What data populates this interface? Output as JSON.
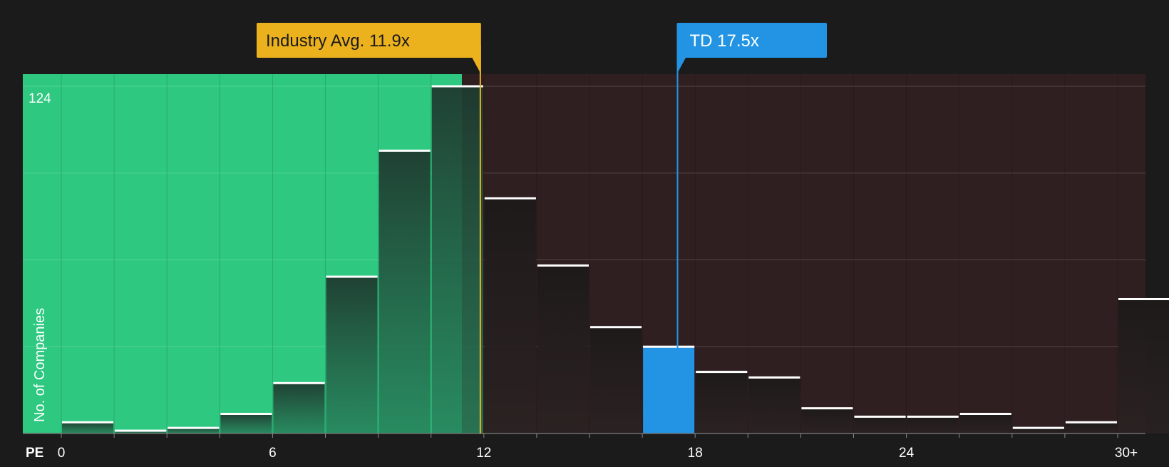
{
  "chart_data": {
    "type": "bar",
    "xlabel": "PE",
    "ylabel": "No. of Companies",
    "y_max_label": "124",
    "ylim": [
      0,
      124
    ],
    "x_tick_labels": [
      {
        "value": 0,
        "label": "0"
      },
      {
        "value": 6,
        "label": "6"
      },
      {
        "value": 12,
        "label": "12"
      },
      {
        "value": 18,
        "label": "18"
      },
      {
        "value": 24,
        "label": "24"
      },
      {
        "value": 30,
        "label": "30+"
      }
    ],
    "bin_width": 1.5,
    "bins": [
      {
        "start": 0,
        "value": 4
      },
      {
        "start": 1.5,
        "value": 1
      },
      {
        "start": 3,
        "value": 2
      },
      {
        "start": 4.5,
        "value": 7
      },
      {
        "start": 6,
        "value": 18
      },
      {
        "start": 7.5,
        "value": 56
      },
      {
        "start": 9,
        "value": 101
      },
      {
        "start": 10.5,
        "value": 124
      },
      {
        "start": 12,
        "value": 84
      },
      {
        "start": 13.5,
        "value": 60
      },
      {
        "start": 15,
        "value": 38
      },
      {
        "start": 16.5,
        "value": 31
      },
      {
        "start": 18,
        "value": 22
      },
      {
        "start": 19.5,
        "value": 20
      },
      {
        "start": 21,
        "value": 9
      },
      {
        "start": 22.5,
        "value": 6
      },
      {
        "start": 24,
        "value": 6
      },
      {
        "start": 25.5,
        "value": 7
      },
      {
        "start": 27,
        "value": 2
      },
      {
        "start": 28.5,
        "value": 4
      },
      {
        "start": 30,
        "value": 48
      }
    ],
    "highlight_bin_start": 16.5,
    "markers": {
      "industry": {
        "label": "Industry Avg. 11.9x",
        "value": 11.9
      },
      "company": {
        "label": "TD 17.5x",
        "value": 17.5
      }
    },
    "colors": {
      "background": "#1b1b1c",
      "undervalued_zone": "#2ec880",
      "overvalued_zone": "#2f1f20",
      "industry_marker": "#ecb21e",
      "company_marker": "#2394e3",
      "bar_cap": "#ffffff",
      "gridline": "#5a4a4b"
    },
    "grid": true
  }
}
